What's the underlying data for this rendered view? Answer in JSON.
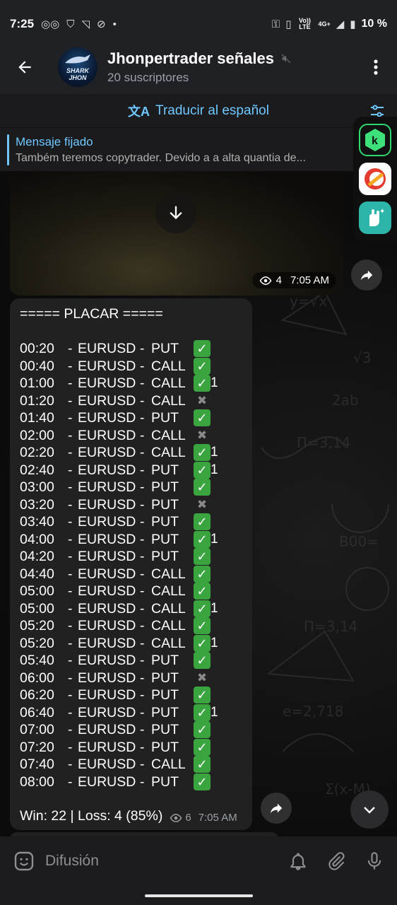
{
  "status_bar": {
    "time": "7:25",
    "network_label_1": "Vo)) LTE",
    "network_label_2": "4G+",
    "battery": "10 %"
  },
  "header": {
    "avatar_text_1": "SHARK",
    "avatar_text_2": "JHON",
    "channel_name": "Jhonpertrader señales",
    "subscribers": "20 suscriptores"
  },
  "translate_bar": {
    "label": "Traducir al español",
    "icon": "translate-icon"
  },
  "pinned": {
    "title": "Mensaje fijado",
    "text": "Também teremos copytrader. Devido a a alta quantia de..."
  },
  "media_message": {
    "views": "4",
    "time": "7:05 AM"
  },
  "signals_message": {
    "header": "===== PLACAR =====",
    "rows": [
      {
        "time": "00:20",
        "pair": "EURUSD",
        "dir": "PUT",
        "result": "win",
        "gale": ""
      },
      {
        "time": "00:40",
        "pair": "EURUSD",
        "dir": "CALL",
        "result": "win",
        "gale": ""
      },
      {
        "time": "01:00",
        "pair": "EURUSD",
        "dir": "CALL",
        "result": "win",
        "gale": "1"
      },
      {
        "time": "01:20",
        "pair": "EURUSD",
        "dir": "CALL",
        "result": "loss",
        "gale": ""
      },
      {
        "time": "01:40",
        "pair": "EURUSD",
        "dir": "PUT",
        "result": "win",
        "gale": ""
      },
      {
        "time": "02:00",
        "pair": "EURUSD",
        "dir": "CALL",
        "result": "loss",
        "gale": ""
      },
      {
        "time": "02:20",
        "pair": "EURUSD",
        "dir": "CALL",
        "result": "win",
        "gale": "1"
      },
      {
        "time": "02:40",
        "pair": "EURUSD",
        "dir": "PUT",
        "result": "win",
        "gale": "1"
      },
      {
        "time": "03:00",
        "pair": "EURUSD",
        "dir": "PUT",
        "result": "win",
        "gale": ""
      },
      {
        "time": "03:20",
        "pair": "EURUSD",
        "dir": "PUT",
        "result": "loss",
        "gale": ""
      },
      {
        "time": "03:40",
        "pair": "EURUSD",
        "dir": "PUT",
        "result": "win",
        "gale": ""
      },
      {
        "time": "04:00",
        "pair": "EURUSD",
        "dir": "PUT",
        "result": "win",
        "gale": "1"
      },
      {
        "time": "04:20",
        "pair": "EURUSD",
        "dir": "PUT",
        "result": "win",
        "gale": ""
      },
      {
        "time": "04:40",
        "pair": "EURUSD",
        "dir": "CALL",
        "result": "win",
        "gale": ""
      },
      {
        "time": "05:00",
        "pair": "EURUSD",
        "dir": "CALL",
        "result": "win",
        "gale": ""
      },
      {
        "time": "05:00",
        "pair": "EURUSD",
        "dir": "CALL",
        "result": "win",
        "gale": "1"
      },
      {
        "time": "05:20",
        "pair": "EURUSD",
        "dir": "CALL",
        "result": "win",
        "gale": ""
      },
      {
        "time": "05:20",
        "pair": "EURUSD",
        "dir": "CALL",
        "result": "win",
        "gale": "1"
      },
      {
        "time": "05:40",
        "pair": "EURUSD",
        "dir": "PUT",
        "result": "win",
        "gale": ""
      },
      {
        "time": "06:00",
        "pair": "EURUSD",
        "dir": "PUT",
        "result": "loss",
        "gale": ""
      },
      {
        "time": "06:20",
        "pair": "EURUSD",
        "dir": "PUT",
        "result": "win",
        "gale": ""
      },
      {
        "time": "06:40",
        "pair": "EURUSD",
        "dir": "PUT",
        "result": "win",
        "gale": "1"
      },
      {
        "time": "07:00",
        "pair": "EURUSD",
        "dir": "PUT",
        "result": "win",
        "gale": ""
      },
      {
        "time": "07:20",
        "pair": "EURUSD",
        "dir": "PUT",
        "result": "win",
        "gale": ""
      },
      {
        "time": "07:40",
        "pair": "EURUSD",
        "dir": "CALL",
        "result": "win",
        "gale": ""
      },
      {
        "time": "08:00",
        "pair": "EURUSD",
        "dir": "PUT",
        "result": "win",
        "gale": ""
      }
    ],
    "summary": "Win: 22 | Loss: 4 (85%)",
    "views": "6",
    "time": "7:05 AM"
  },
  "bottom_bar": {
    "placeholder": "Difusión"
  },
  "colors": {
    "accent": "#6fc7ff",
    "bubble": "#212121",
    "bar": "#202124",
    "win": "#3aa53f"
  },
  "side_apps": [
    "k-app-icon",
    "ccleaner-icon",
    "hand-sparkle-app-icon"
  ]
}
